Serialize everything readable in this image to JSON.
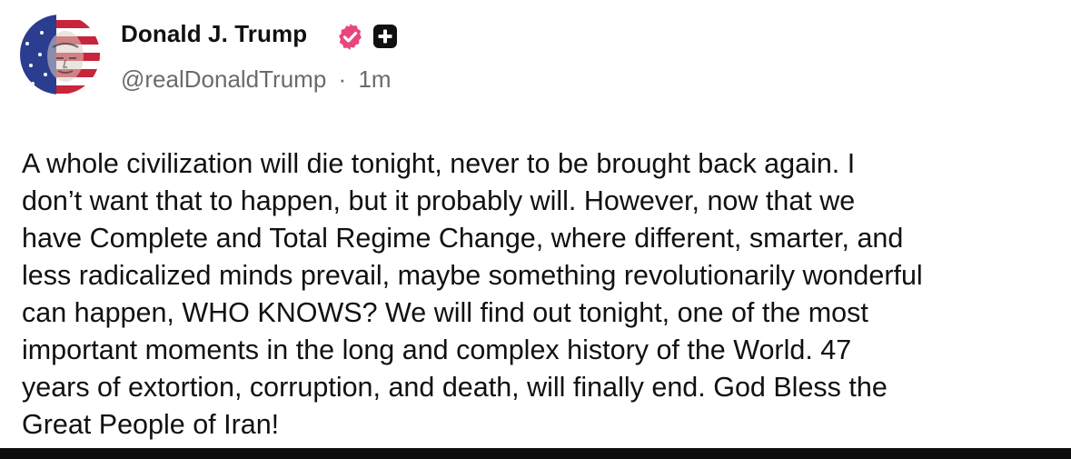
{
  "author": {
    "display_name": "Donald J. Trump",
    "handle": "@realDonaldTrump",
    "separator": "·",
    "timestamp": "1m"
  },
  "post": {
    "text": "A whole civilization will die tonight, never to be brought back again. I\ndon’t want that to happen, but it probably will. However, now that we\nhave Complete and Total Regime Change, where different, smarter, and\nless radicalized minds prevail, maybe something revolutionarily wonderful\ncan happen, WHO KNOWS? We will find out tonight, one of the most\nimportant moments in the long and complex history of the World. 47\nyears of extortion, corruption, and death, will finally end. God Bless the\nGreat People of Iran!"
  },
  "icons": {
    "verified": "verified-badge-icon",
    "plus": "plus-badge-icon"
  },
  "colors": {
    "verified_badge": "#e8457a",
    "plus_badge": "#111111",
    "handle_text": "#6b6b6b",
    "body_text": "#111111"
  }
}
